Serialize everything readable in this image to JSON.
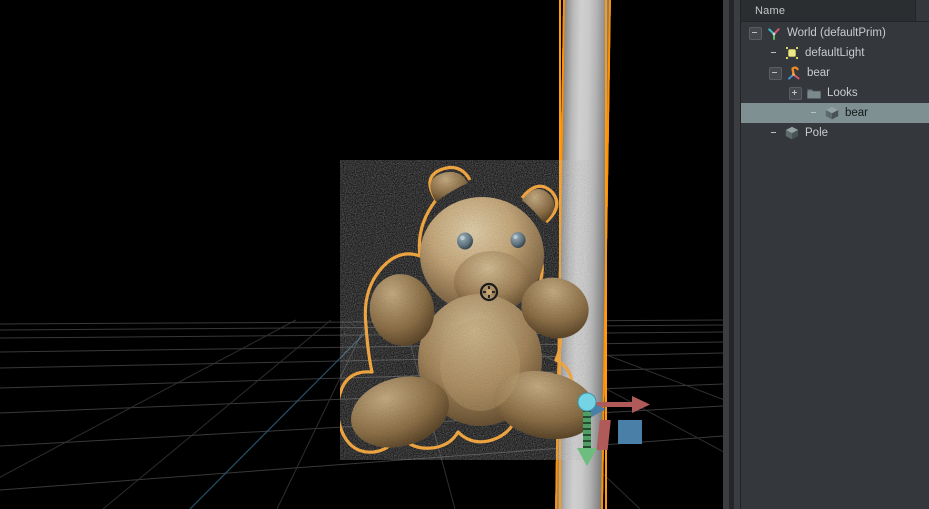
{
  "app": {
    "viewport_background": "#000000",
    "selection_outline_color": "#ff9a11",
    "panel_background": "#34373b",
    "selected_row_color": "#7e9091"
  },
  "stage_panel": {
    "header": {
      "column_name": "Name"
    },
    "rows": [
      {
        "label": "World (defaultPrim)",
        "icon": "axes-gizmo-icon",
        "twisty": "minus",
        "indent": 0,
        "selected": false
      },
      {
        "label": "defaultLight",
        "icon": "light-icon",
        "twisty": "none",
        "indent": 1,
        "selected": false
      },
      {
        "label": "bear",
        "icon": "axes-gizmo-orange-icon",
        "twisty": "minus",
        "indent": 1,
        "selected": false
      },
      {
        "label": "Looks",
        "icon": "folder-icon",
        "twisty": "plus",
        "indent": 2,
        "selected": false
      },
      {
        "label": "bear",
        "icon": "mesh-cube-icon",
        "twisty": "none",
        "indent": 3,
        "selected": true
      },
      {
        "label": "Pole",
        "icon": "mesh-cube-icon",
        "twisty": "none",
        "indent": 1,
        "selected": false
      }
    ]
  },
  "viewport": {
    "objects": [
      {
        "name": "bear",
        "type": "mesh",
        "selected": true,
        "outline": "#ff9a11"
      },
      {
        "name": "Pole",
        "type": "cylinder",
        "selected": true,
        "outline": "#ff9a11"
      }
    ],
    "grid": {
      "visible": true,
      "color": "#3a3a3a"
    },
    "gizmo": {
      "type": "translate-manipulator",
      "center_color": "#74d4e6",
      "axis_x_color": "#b05a5a",
      "axis_y_color": "#4a7fa8",
      "axis_z_color": "#4f9e63",
      "plane_xz_color": "#b05a5a",
      "plane_xy_color": "#4a7fa8"
    }
  }
}
